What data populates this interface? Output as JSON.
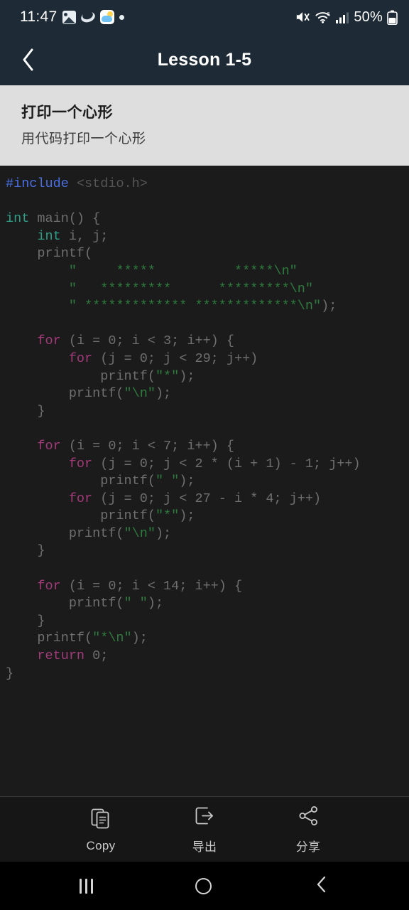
{
  "status_bar": {
    "time": "11:47",
    "battery_percent": "50%",
    "left_icons": [
      "photos-icon",
      "saturn-icon",
      "weather-icon",
      "dot-icon"
    ],
    "right_icons": [
      "mute-icon",
      "wifi-6-icon",
      "cellular-signal-icon",
      "battery-icon"
    ],
    "background_color": "#1e2a35"
  },
  "header": {
    "back_label": "chevron-left-icon",
    "title": "Lesson 1-5",
    "background_color": "#1e2a35",
    "title_color": "#ffffff"
  },
  "info_panel": {
    "title": "打印一个心形",
    "subtitle": "用代码打印一个心形",
    "background_color": "#dedede"
  },
  "code_view": {
    "language": "c",
    "background_color": "#1b1b1b",
    "colors": {
      "preprocessor": "#4a6fe3",
      "type_keyword": "#2e9e86",
      "control_keyword": "#a33a7a",
      "string": "#2f7a3f",
      "identifier": "#7d7d7d",
      "header_name": "#555555"
    },
    "lines": [
      [
        {
          "t": "#include",
          "c": "kw-inc"
        },
        {
          "t": " ",
          "c": "plain"
        },
        {
          "t": "<stdio.h>",
          "c": "hdr"
        }
      ],
      [],
      [
        {
          "t": "int",
          "c": "kw-type"
        },
        {
          "t": " main() {",
          "c": "plain"
        }
      ],
      [
        {
          "t": "    ",
          "c": "plain"
        },
        {
          "t": "int",
          "c": "kw-type"
        },
        {
          "t": " i, j;",
          "c": "plain"
        }
      ],
      [
        {
          "t": "    printf(",
          "c": "plain"
        }
      ],
      [
        {
          "t": "        ",
          "c": "plain"
        },
        {
          "t": "\"     *****          *****\\n\"",
          "c": "str"
        }
      ],
      [
        {
          "t": "        ",
          "c": "plain"
        },
        {
          "t": "\"   *********      *********\\n\"",
          "c": "str"
        }
      ],
      [
        {
          "t": "        ",
          "c": "plain"
        },
        {
          "t": "\" ************* *************\\n\"",
          "c": "str"
        },
        {
          "t": ");",
          "c": "plain"
        }
      ],
      [],
      [
        {
          "t": "    ",
          "c": "plain"
        },
        {
          "t": "for",
          "c": "kw-ctl"
        },
        {
          "t": " (i = 0; i < 3; i++) {",
          "c": "plain"
        }
      ],
      [
        {
          "t": "        ",
          "c": "plain"
        },
        {
          "t": "for",
          "c": "kw-ctl"
        },
        {
          "t": " (j = 0; j < 29; j++)",
          "c": "plain"
        }
      ],
      [
        {
          "t": "            printf(",
          "c": "plain"
        },
        {
          "t": "\"*\"",
          "c": "str"
        },
        {
          "t": ");",
          "c": "plain"
        }
      ],
      [
        {
          "t": "        printf(",
          "c": "plain"
        },
        {
          "t": "\"\\n\"",
          "c": "str"
        },
        {
          "t": ");",
          "c": "plain"
        }
      ],
      [
        {
          "t": "    }",
          "c": "plain"
        }
      ],
      [],
      [
        {
          "t": "    ",
          "c": "plain"
        },
        {
          "t": "for",
          "c": "kw-ctl"
        },
        {
          "t": " (i = 0; i < 7; i++) {",
          "c": "plain"
        }
      ],
      [
        {
          "t": "        ",
          "c": "plain"
        },
        {
          "t": "for",
          "c": "kw-ctl"
        },
        {
          "t": " (j = 0; j < 2 * (i + 1) - 1; j++)",
          "c": "plain"
        }
      ],
      [
        {
          "t": "            printf(",
          "c": "plain"
        },
        {
          "t": "\" \"",
          "c": "str"
        },
        {
          "t": ");",
          "c": "plain"
        }
      ],
      [
        {
          "t": "        ",
          "c": "plain"
        },
        {
          "t": "for",
          "c": "kw-ctl"
        },
        {
          "t": " (j = 0; j < 27 - i * 4; j++)",
          "c": "plain"
        }
      ],
      [
        {
          "t": "            printf(",
          "c": "plain"
        },
        {
          "t": "\"*\"",
          "c": "str"
        },
        {
          "t": ");",
          "c": "plain"
        }
      ],
      [
        {
          "t": "        printf(",
          "c": "plain"
        },
        {
          "t": "\"\\n\"",
          "c": "str"
        },
        {
          "t": ");",
          "c": "plain"
        }
      ],
      [
        {
          "t": "    }",
          "c": "plain"
        }
      ],
      [],
      [
        {
          "t": "    ",
          "c": "plain"
        },
        {
          "t": "for",
          "c": "kw-ctl"
        },
        {
          "t": " (i = 0; i < 14; i++) {",
          "c": "plain"
        }
      ],
      [
        {
          "t": "        printf(",
          "c": "plain"
        },
        {
          "t": "\" \"",
          "c": "str"
        },
        {
          "t": ");",
          "c": "plain"
        }
      ],
      [
        {
          "t": "    }",
          "c": "plain"
        }
      ],
      [
        {
          "t": "    printf(",
          "c": "plain"
        },
        {
          "t": "\"*\\n\"",
          "c": "str"
        },
        {
          "t": ");",
          "c": "plain"
        }
      ],
      [
        {
          "t": "    ",
          "c": "plain"
        },
        {
          "t": "return",
          "c": "kw-ctl"
        },
        {
          "t": " 0;",
          "c": "plain"
        }
      ],
      [
        {
          "t": "}",
          "c": "plain"
        }
      ]
    ]
  },
  "toolbar": {
    "buttons": [
      {
        "label": "Copy",
        "icon": "copy-icon"
      },
      {
        "label": "导出",
        "icon": "export-icon"
      },
      {
        "label": "分享",
        "icon": "share-icon"
      }
    ],
    "background_color": "#161616"
  },
  "nav_bar": {
    "recents_label": "recents-icon",
    "home_label": "home-icon",
    "back_label": "back-icon",
    "background_color": "#000000"
  }
}
